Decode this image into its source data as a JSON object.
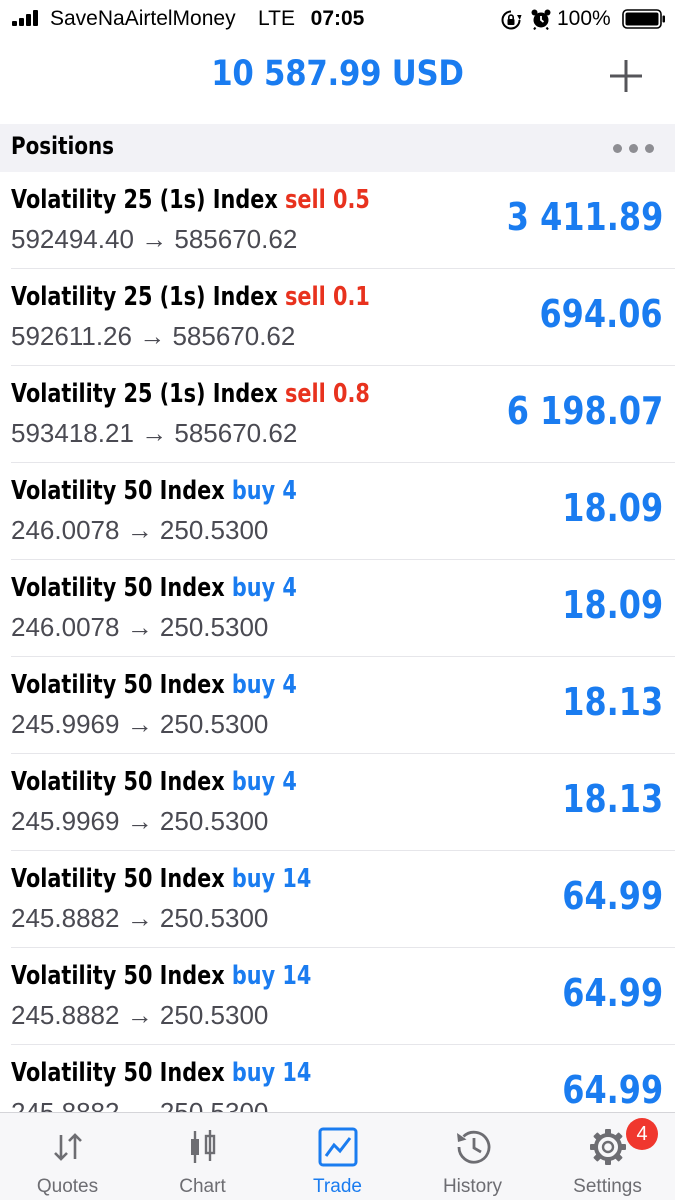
{
  "status_bar": {
    "carrier": "SaveNaAirtelMoney",
    "network": "LTE",
    "time": "07:05",
    "battery": "100%"
  },
  "header": {
    "balance": "10 587.99 USD",
    "add_icon": "plus-icon"
  },
  "section": {
    "title": "Positions",
    "more_icon": "more-dots-icon"
  },
  "positions": [
    {
      "symbol": "Volatility 25 (1s) Index",
      "side": "sell",
      "volume": "0.5",
      "open_price": "592494.40",
      "arrow": "→",
      "current_price": "585670.62",
      "profit": "3 411.89"
    },
    {
      "symbol": "Volatility 25 (1s) Index",
      "side": "sell",
      "volume": "0.1",
      "open_price": "592611.26",
      "arrow": "→",
      "current_price": "585670.62",
      "profit": "694.06"
    },
    {
      "symbol": "Volatility 25 (1s) Index",
      "side": "sell",
      "volume": "0.8",
      "open_price": "593418.21",
      "arrow": "→",
      "current_price": "585670.62",
      "profit": "6 198.07"
    },
    {
      "symbol": "Volatility 50 Index",
      "side": "buy",
      "volume": "4",
      "open_price": "246.0078",
      "arrow": "→",
      "current_price": "250.5300",
      "profit": "18.09"
    },
    {
      "symbol": "Volatility 50 Index",
      "side": "buy",
      "volume": "4",
      "open_price": "246.0078",
      "arrow": "→",
      "current_price": "250.5300",
      "profit": "18.09"
    },
    {
      "symbol": "Volatility 50 Index",
      "side": "buy",
      "volume": "4",
      "open_price": "245.9969",
      "arrow": "→",
      "current_price": "250.5300",
      "profit": "18.13"
    },
    {
      "symbol": "Volatility 50 Index",
      "side": "buy",
      "volume": "4",
      "open_price": "245.9969",
      "arrow": "→",
      "current_price": "250.5300",
      "profit": "18.13"
    },
    {
      "symbol": "Volatility 50 Index",
      "side": "buy",
      "volume": "14",
      "open_price": "245.8882",
      "arrow": "→",
      "current_price": "250.5300",
      "profit": "64.99"
    },
    {
      "symbol": "Volatility 50 Index",
      "side": "buy",
      "volume": "14",
      "open_price": "245.8882",
      "arrow": "→",
      "current_price": "250.5300",
      "profit": "64.99"
    },
    {
      "symbol": "Volatility 50 Index",
      "side": "buy",
      "volume": "14",
      "open_price": "245.8882",
      "arrow": "→",
      "current_price": "250.5300",
      "profit": "64.99"
    }
  ],
  "colors": {
    "accent": "#1a7cf0",
    "sell": "#e8321e",
    "buy": "#1a7cf0",
    "badge": "#f0372e"
  },
  "tabs": [
    {
      "label": "Quotes",
      "icon": "quotes-arrows-icon",
      "active": false
    },
    {
      "label": "Chart",
      "icon": "candlestick-chart-icon",
      "active": false
    },
    {
      "label": "Trade",
      "icon": "trade-chart-icon",
      "active": true
    },
    {
      "label": "History",
      "icon": "history-clock-icon",
      "active": false
    },
    {
      "label": "Settings",
      "icon": "gear-icon",
      "active": false,
      "badge": "4"
    }
  ]
}
